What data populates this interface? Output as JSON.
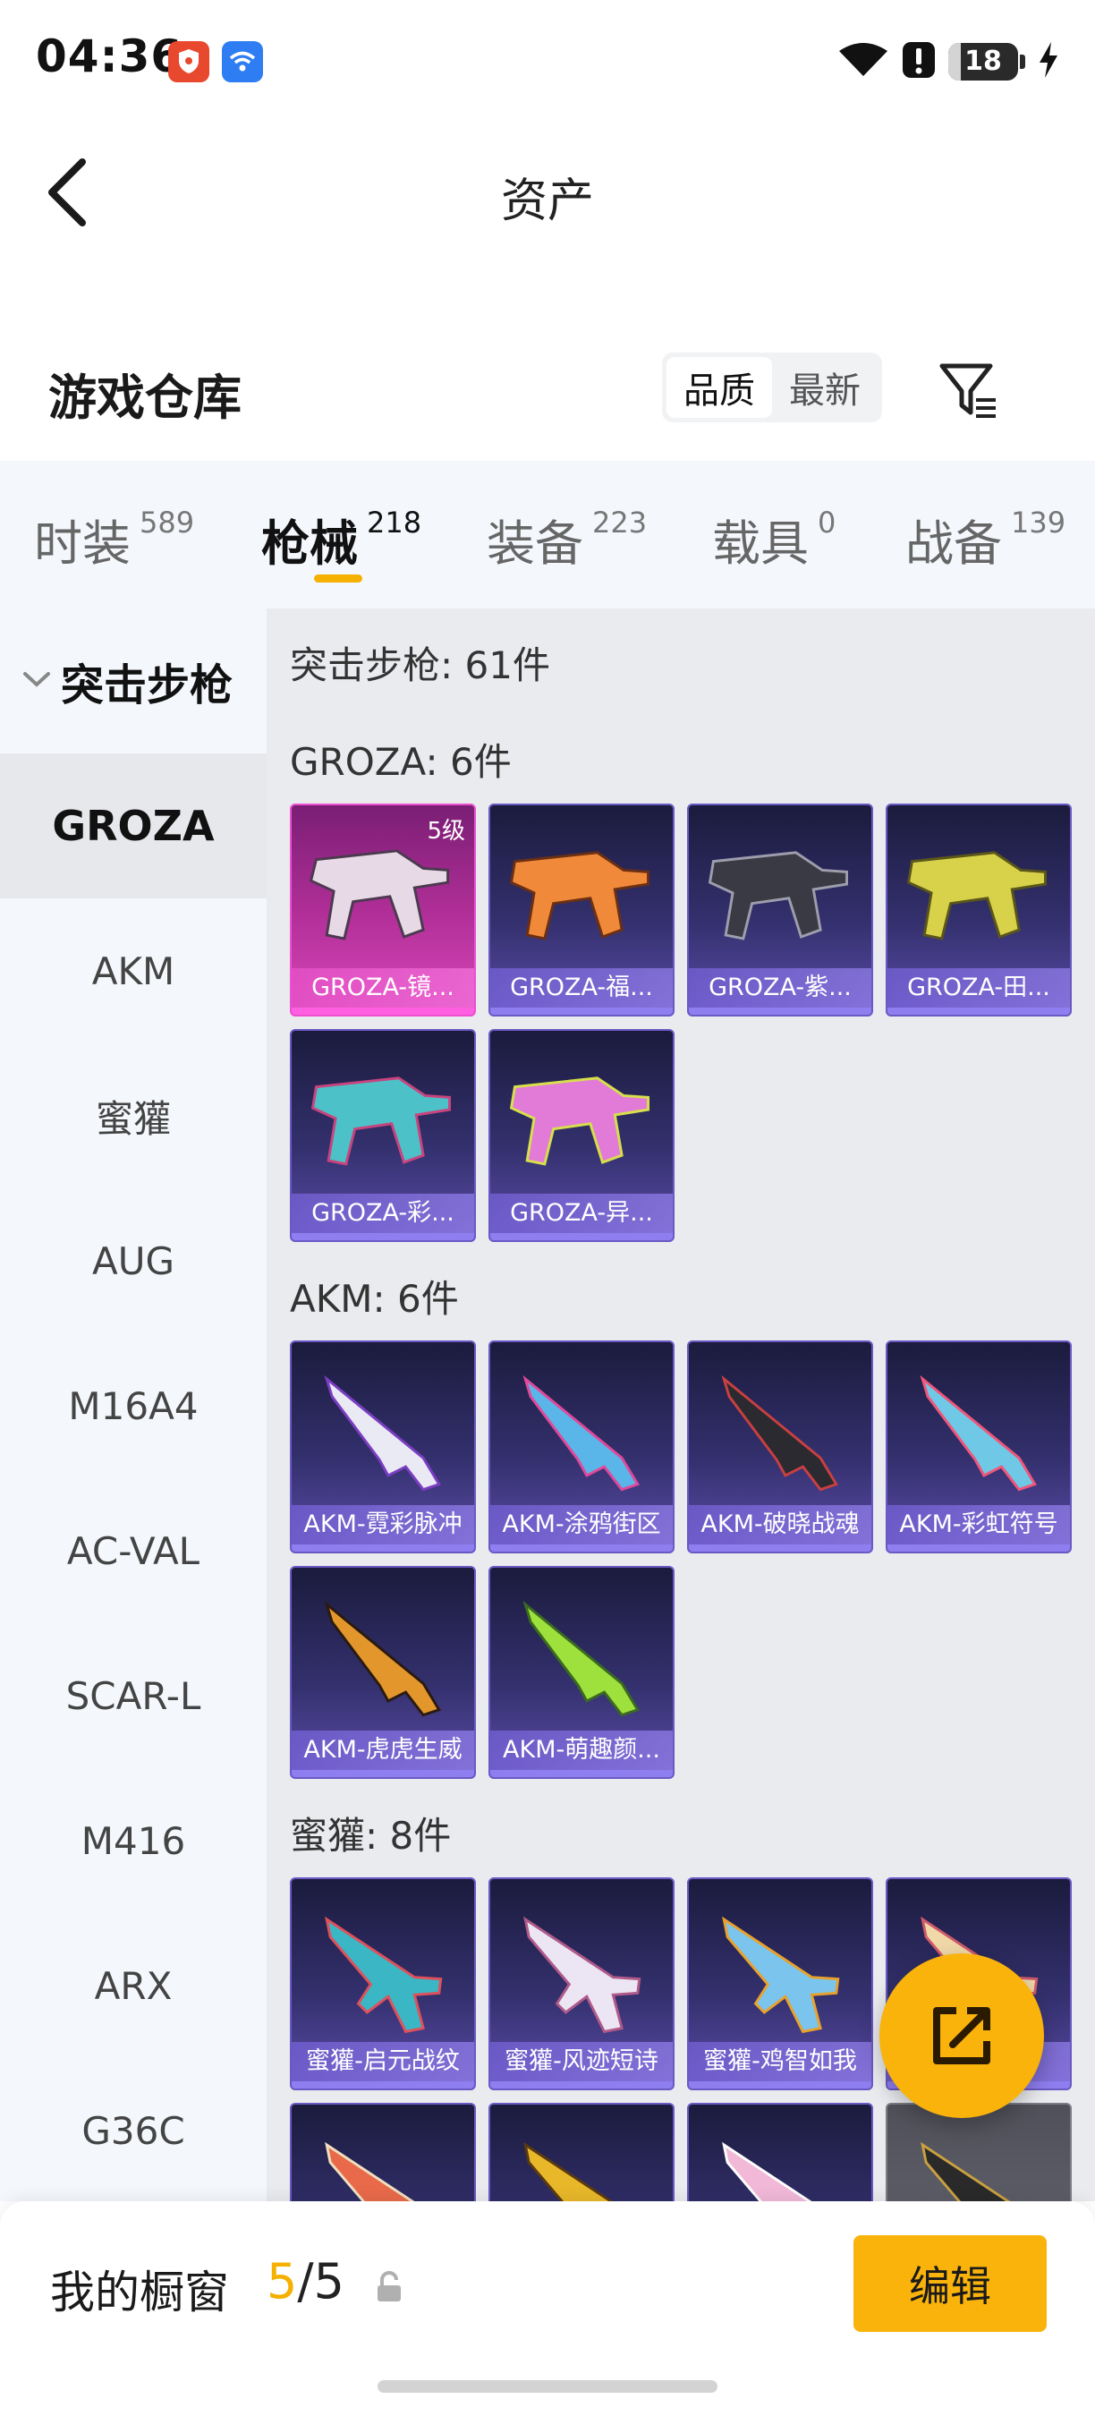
{
  "status_bar": {
    "time": "04:36",
    "battery": "18",
    "battery_level": 0.18
  },
  "header": {
    "title": "资产"
  },
  "section": {
    "title": "游戏仓库",
    "sort_options": [
      "品质",
      "最新"
    ],
    "active_sort": "品质"
  },
  "categories": [
    {
      "label": "时装",
      "count": "589"
    },
    {
      "label": "枪械",
      "count": "218"
    },
    {
      "label": "装备",
      "count": "223"
    },
    {
      "label": "载具",
      "count": "0"
    },
    {
      "label": "战备",
      "count": "139"
    }
  ],
  "active_category": "枪械",
  "sidebar": {
    "group": "突击步枪",
    "items": [
      "GROZA",
      "AKM",
      "蜜獾",
      "AUG",
      "M16A4",
      "AC-VAL",
      "SCAR-L",
      "M416",
      "ARX",
      "G36C"
    ],
    "active": "GROZA"
  },
  "content": {
    "header": "突击步枪: 61件",
    "groups": [
      {
        "title": "GROZA: 6件",
        "items": [
          {
            "name": "GROZA-镜...",
            "level": "5级"
          },
          {
            "name": "GROZA-福..."
          },
          {
            "name": "GROZA-紫..."
          },
          {
            "name": "GROZA-田..."
          },
          {
            "name": "GROZA-彩..."
          },
          {
            "name": "GROZA-异..."
          }
        ]
      },
      {
        "title": "AKM: 6件",
        "items": [
          {
            "name": "AKM-霓彩脉冲"
          },
          {
            "name": "AKM-涂鸦街区"
          },
          {
            "name": "AKM-破晓战魂"
          },
          {
            "name": "AKM-彩虹符号"
          },
          {
            "name": "AKM-虎虎生威"
          },
          {
            "name": "AKM-萌趣颜..."
          }
        ]
      },
      {
        "title": "蜜獾: 8件",
        "items": [
          {
            "name": "蜜獾-启元战纹"
          },
          {
            "name": "蜜獾-风迹短诗"
          },
          {
            "name": "蜜獾-鸡智如我"
          },
          {
            "name": ""
          },
          {
            "name": ""
          },
          {
            "name": ""
          },
          {
            "name": ""
          },
          {
            "name": ""
          }
        ]
      }
    ]
  },
  "bottom_bar": {
    "label": "我的橱窗",
    "used": "5",
    "separator": "/",
    "total": "5",
    "edit_label": "编辑"
  },
  "colors": {
    "accent": "#f9b30b",
    "card_purple": "#33306d",
    "card_pink": "#b4309a"
  },
  "icons": [
    "shield-app-icon",
    "wifi-app-icon",
    "wifi-icon",
    "alert-icon",
    "battery-icon",
    "charging-icon",
    "back-arrow-icon",
    "filter-icon",
    "chevron-down-icon",
    "share-icon",
    "lock-icon"
  ]
}
